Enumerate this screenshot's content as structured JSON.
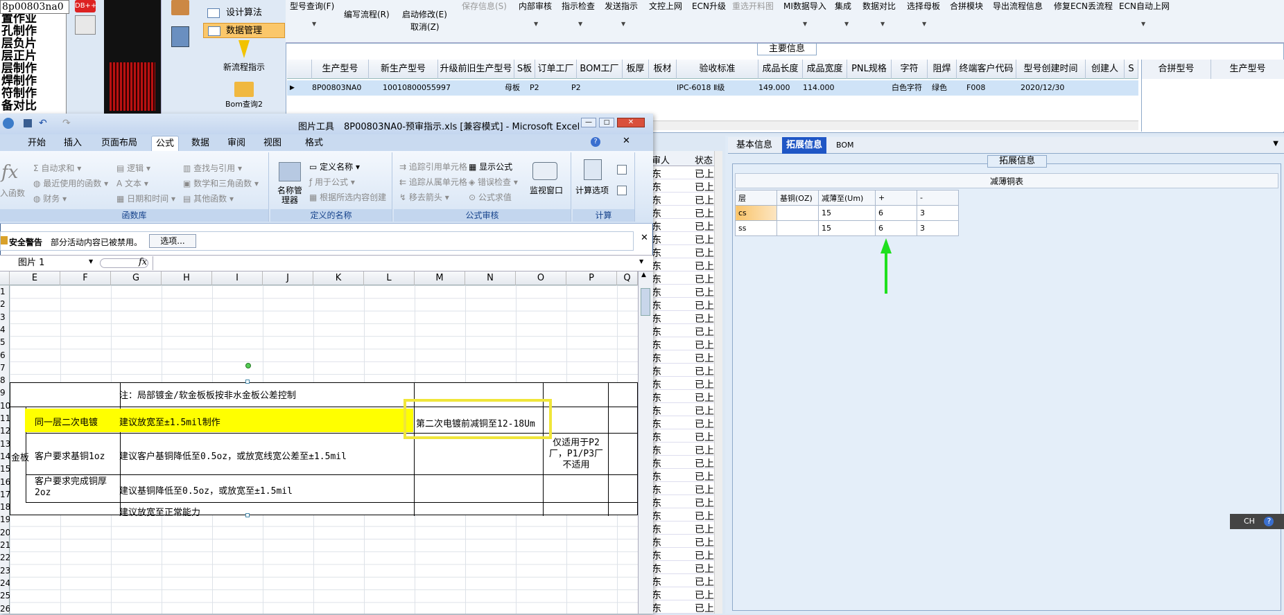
{
  "left": {
    "search_value": "8p00803na0",
    "badge": "DB++",
    "items": [
      "置作业",
      "孔制作",
      "层负片",
      "层正片",
      "层制作",
      "焊制作",
      "符制作",
      "备对比"
    ]
  },
  "nav": {
    "design_algo": "设计算法",
    "data_mgmt": "数据管理",
    "new_flow": "新流程指示",
    "bom_query": "Bom查询2"
  },
  "toolbar": {
    "row1": [
      "型号查询(F)",
      "保存信息(S)",
      "内部审核",
      "指示检查",
      "发送指示",
      "文控上网",
      "ECN升级",
      "重选开料图",
      "MI数据导入",
      "集成",
      "数据对比",
      "选择母板",
      "合拼模块",
      "导出流程信息",
      "修复ECN丢流程",
      "ECN自动上网"
    ],
    "write_flow": "编写流程(R)",
    "start_modify": "启动修改(E)",
    "cancel": "取消(Z)"
  },
  "main_info": {
    "title": "主要信息",
    "headers": [
      "生产型号",
      "新生产型号",
      "升级前旧生产型号",
      "S板",
      "订单工厂",
      "BOM工厂",
      "板厚",
      "板材",
      "验收标准",
      "成品长度",
      "成品宽度",
      "PNL规格",
      "字符",
      "阻焊",
      "终端客户代码",
      "型号创建时间",
      "创建人",
      "S"
    ],
    "row": [
      "8P00803NA0",
      "10010800055997",
      "",
      "母板",
      "P2",
      "P2",
      "",
      "",
      "IPC-6018 Ⅱ级",
      "149.000",
      "114.000",
      "",
      "白色字符",
      "绿色",
      "F008",
      "2020/12/30",
      "",
      ""
    ],
    "right_headers": [
      "合拼型号",
      "生产型号"
    ]
  },
  "mid": {
    "headers": [
      "审人",
      "状态"
    ],
    "rows": [
      [
        "东",
        "已上"
      ],
      [
        "东",
        "已上"
      ],
      [
        "东",
        "已上"
      ],
      [
        "东",
        "已上"
      ],
      [
        "东",
        "已上"
      ],
      [
        "东",
        "已上"
      ],
      [
        "东",
        "已上"
      ],
      [
        "东",
        "已上"
      ],
      [
        "东",
        "已上"
      ],
      [
        "东",
        "已上"
      ],
      [
        "东",
        "已上"
      ],
      [
        "东",
        "已上"
      ],
      [
        "东",
        "已上"
      ],
      [
        "东",
        "已上"
      ],
      [
        "东",
        "已上"
      ],
      [
        "东",
        "已上"
      ],
      [
        "东",
        "已上"
      ],
      [
        "东",
        "已上"
      ],
      [
        "东",
        "已上"
      ],
      [
        "东",
        "已上"
      ],
      [
        "东",
        "已上"
      ],
      [
        "东",
        "已上"
      ],
      [
        "东",
        "已上"
      ],
      [
        "东",
        "已上"
      ],
      [
        "东",
        "已上"
      ],
      [
        "东",
        "已上"
      ],
      [
        "东",
        "已上"
      ],
      [
        "东",
        "已上"
      ],
      [
        "东",
        "已上"
      ],
      [
        "东",
        "已上"
      ],
      [
        "东",
        "已上"
      ],
      [
        "东",
        "已上"
      ],
      [
        "东",
        "已上"
      ],
      [
        "东",
        "已上"
      ]
    ]
  },
  "ext": {
    "tabs": [
      "基本信息",
      "拓展信息",
      "BOM"
    ],
    "group_title": "拓展信息",
    "table_title": "减薄铜表",
    "headers": [
      "层",
      "基铜(OZ)",
      "减薄至(Um)",
      "+",
      "-"
    ],
    "rows": [
      [
        "cs",
        "",
        "15",
        "6",
        "3"
      ],
      [
        "ss",
        "",
        "15",
        "6",
        "3"
      ]
    ]
  },
  "ime": {
    "label": "CH"
  },
  "excel": {
    "title": "8P00803NA0-预审指示.xls [兼容模式] - Microsoft Excel",
    "tool_ctx": "图片工具",
    "tabs": [
      "开始",
      "插入",
      "页面布局",
      "公式",
      "数据",
      "审阅",
      "视图",
      "格式"
    ],
    "ribbon": {
      "insert_fn": "入函数",
      "autosum": "自动求和",
      "recent": "最近使用的函数",
      "finance": "财务",
      "logic": "逻辑",
      "text": "文本",
      "datetime": "日期和时间",
      "lookup": "查找与引用",
      "math": "数学和三角函数",
      "other": "其他函数",
      "lib_label": "函数库",
      "name_mgr": "名称管理器",
      "define_name": "定义名称",
      "use_in_formula": "用于公式",
      "create_from_sel": "根据所选内容创建",
      "names_label": "定义的名称",
      "trace_prec": "追踪引用单元格",
      "trace_dep": "追踪从属单元格",
      "remove_arrows": "移去箭头",
      "show_formulas": "显示公式",
      "error_check": "错误检查",
      "evaluate": "公式求值",
      "watch": "监视窗口",
      "audit_label": "公式审核",
      "calc_options": "计算选项",
      "calc_label": "计算"
    },
    "security": {
      "title": "安全警告",
      "msg": "部分活动内容已被禁用。",
      "options": "选项..."
    },
    "name_box": "图片 1",
    "fx": "fx",
    "columns": [
      "E",
      "F",
      "G",
      "H",
      "I",
      "J",
      "K",
      "L",
      "M",
      "N",
      "O",
      "P",
      "Q"
    ],
    "row_nums": [
      "1",
      "2",
      "3",
      "4",
      "5",
      "6",
      "7",
      "8",
      "9",
      "10",
      "11",
      "12",
      "13",
      "14",
      "15",
      "16",
      "17",
      "18",
      "19",
      "20",
      "21",
      "22",
      "23",
      "24",
      "25",
      "26"
    ],
    "cells": {
      "note": "注：局部镀金/软金板板按非水金板公差控制",
      "same_layer": "同一层二次电镀",
      "suggest1": "建议放宽至±1.5mil制作",
      "second_plating": "第二次电镀前减铜至12-18Um",
      "gold_board": "金板",
      "cust_base": "客户要求基铜1oz",
      "suggest2": "建议客户基铜降低至0.5oz，或放宽线宽公差至±1.5mil",
      "apply_p2": "仅适用于P2厂，P1/P3厂不适用",
      "cust_finish": "客户要求完成铜厚2oz",
      "suggest3": "建议基铜降低至0.5oz，或放宽至±1.5mil",
      "suggest4": "建议放宽至正常能力"
    }
  }
}
